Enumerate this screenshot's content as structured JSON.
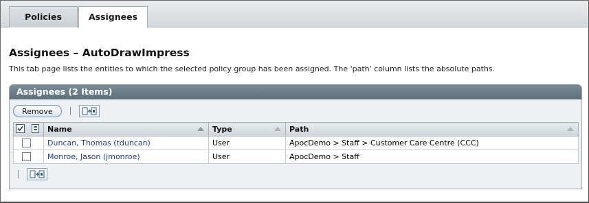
{
  "tabs": [
    {
      "label": "Policies",
      "active": false
    },
    {
      "label": "Assignees",
      "active": true
    }
  ],
  "page": {
    "title": "Assignees – AutoDrawImpress",
    "help": "This tab page lists the entities to which the selected policy group has been assigned. The 'path' column lists the absolute paths."
  },
  "table": {
    "title": "Assignees (2 Items)",
    "remove_label": "Remove",
    "columns": {
      "name": "Name",
      "type": "Type",
      "path": "Path"
    },
    "rows": [
      {
        "name": "Duncan, Thomas (tduncan)",
        "type": "User",
        "path": "ApocDemo > Staff > Customer Care Centre (CCC)"
      },
      {
        "name": "Monroe, Jason (jmonroe)",
        "type": "User",
        "path": "ApocDemo > Staff"
      }
    ]
  },
  "icons": {
    "select_all": "select-all-icon",
    "deselect_all": "deselect-all-icon",
    "move_columns": "move-columns-icon",
    "sort": "sort-ascending-icon"
  },
  "colors": {
    "panel_header": "#5c6f7b",
    "link": "#1f3f8f",
    "button_border": "#6b8fb4"
  }
}
